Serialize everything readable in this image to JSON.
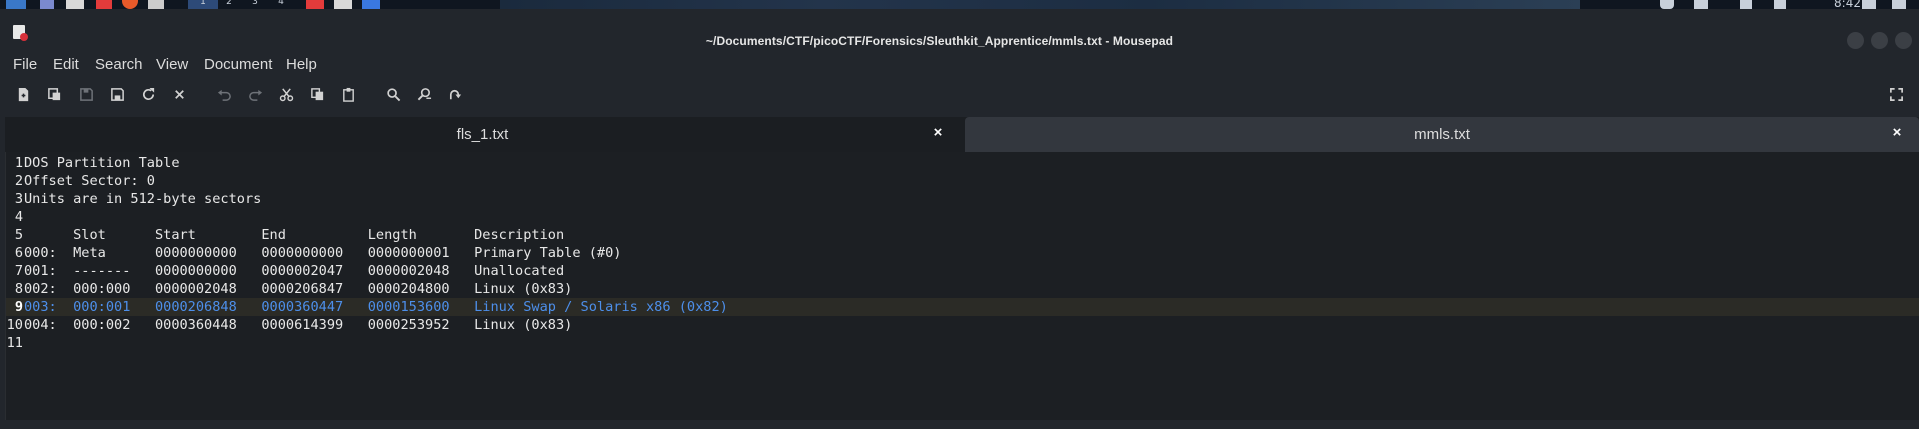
{
  "taskbar": {
    "workspaces": [
      "1",
      "2",
      "3",
      "4"
    ],
    "clock": "8:42"
  },
  "window": {
    "title": "~/Documents/CTF/picoCTF/Forensics/Sleuthkit_Apprentice/mmls.txt - Mousepad"
  },
  "menu": [
    "File",
    "Edit",
    "Search",
    "View",
    "Document",
    "Help"
  ],
  "toolbar": {
    "icons": [
      "new-document-icon",
      "new-window-icon",
      "save-icon",
      "save-as-icon",
      "reload-icon",
      "close-icon",
      "undo-icon",
      "redo-icon",
      "cut-icon",
      "copy-icon",
      "paste-icon",
      "find-icon",
      "find-replace-icon",
      "goto-icon",
      "fullscreen-icon"
    ]
  },
  "tabs": [
    {
      "label": "fls_1.txt",
      "active": false
    },
    {
      "label": "mmls.txt",
      "active": true
    }
  ],
  "editor": {
    "current_line": 9,
    "lines": [
      {
        "n": "1",
        "text": "DOS Partition Table"
      },
      {
        "n": "2",
        "text": "Offset Sector: 0"
      },
      {
        "n": "3",
        "text": "Units are in 512-byte sectors"
      },
      {
        "n": "4",
        "text": ""
      },
      {
        "n": "5",
        "text": "      Slot      Start        End          Length       Description"
      },
      {
        "n": "6",
        "text": "000:  Meta      0000000000   0000000000   0000000001   Primary Table (#0)"
      },
      {
        "n": "7",
        "text": "001:  -------   0000000000   0000002047   0000002048   Unallocated"
      },
      {
        "n": "8",
        "text": "002:  000:000   0000002048   0000206847   0000204800   Linux (0x83)"
      },
      {
        "n": "9",
        "text": "003:  000:001   0000206848   0000360447   0000153600   Linux Swap / Solaris x86 (0x82)"
      },
      {
        "n": "10",
        "text": "004:  000:002   0000360448   0000614399   0000253952   Linux (0x83)"
      },
      {
        "n": "11",
        "text": ""
      }
    ]
  },
  "colors": {
    "background": "#1c1f23",
    "text": "#e8e8e8",
    "selection_text": "#4d8fea",
    "current_line": "#2b2b26"
  }
}
